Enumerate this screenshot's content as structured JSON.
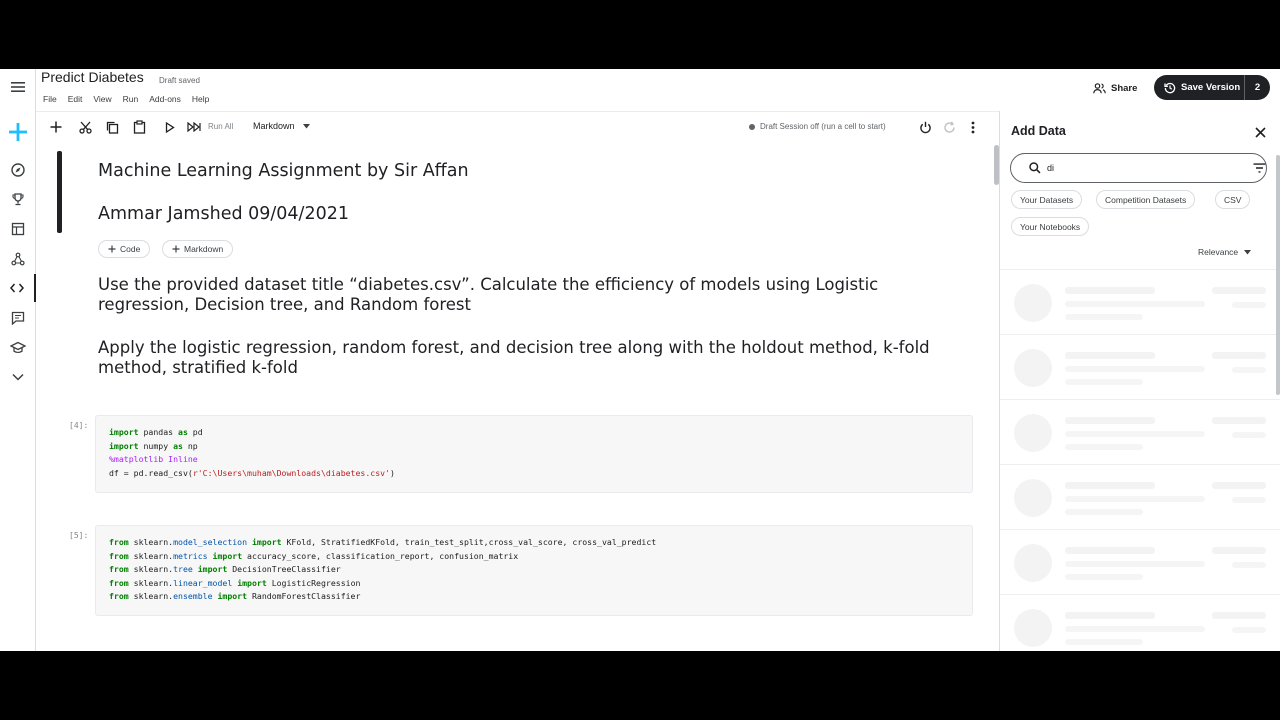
{
  "notebook": {
    "title": "Predict Diabetes",
    "status": "Draft saved"
  },
  "menu": [
    "File",
    "Edit",
    "View",
    "Run",
    "Add-ons",
    "Help"
  ],
  "header": {
    "share_label": "Share",
    "save_version_label": "Save Version",
    "version_count": "2"
  },
  "toolbar": {
    "run_all_label": "Run All",
    "cell_type": "Markdown",
    "session_status": "Draft Session off (run a cell to start)"
  },
  "cells": {
    "md1_heading1": "Machine Learning Assignment by Sir Affan",
    "md1_heading2": "Ammar Jamshed 09/04/2021",
    "add_code_label": "Code",
    "add_markdown_label": "Markdown",
    "md2_text": "Use the provided dataset title “diabetes.csv”. Calculate the efficiency of models using Logistic regression, Decision tree, and Random forest",
    "md3_text": "Apply the logistic regression, random forest, and decision tree along with the holdout method, k-fold method, stratified k-fold",
    "code1_number": "[4]:",
    "code2_number": "[5]:"
  },
  "panel": {
    "title": "Add Data",
    "search_value": "di",
    "chips": [
      "Your Datasets",
      "Competition Datasets",
      "CSV",
      "Your Notebooks"
    ],
    "sort_label": "Relevance"
  },
  "colors": {
    "accent": "#20beff",
    "dark": "#202124"
  }
}
